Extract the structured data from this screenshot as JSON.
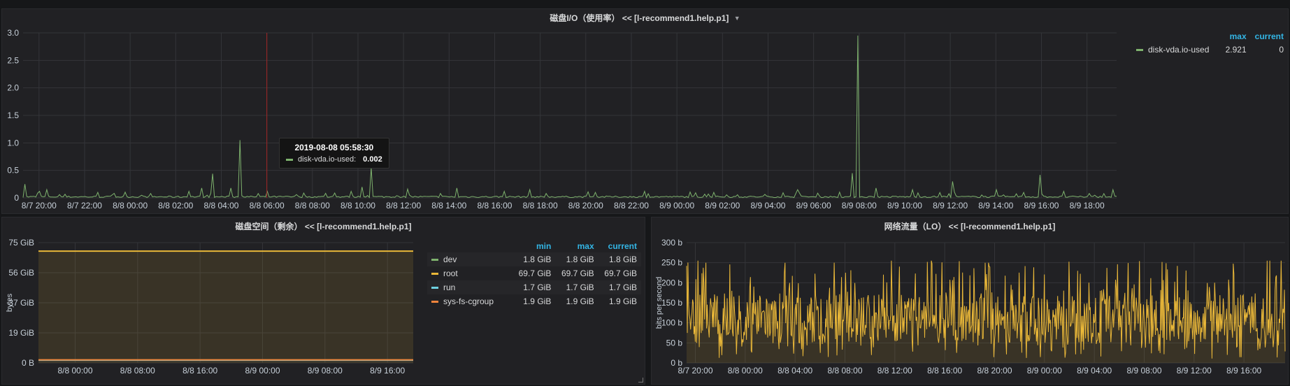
{
  "panels": {
    "io": {
      "title_cn": "磁盘I/O（使用率）",
      "title_host": "<< [l-recommend1.help.p1]",
      "chart_data": {
        "type": "line",
        "xlabel": "",
        "ylabel": "",
        "ylim": [
          0,
          3.0
        ],
        "y_ticks": [
          "0",
          "0.5",
          "1.0",
          "1.5",
          "2.0",
          "2.5",
          "3.0"
        ],
        "x_ticks": [
          "8/7 20:00",
          "8/7 22:00",
          "8/8 00:00",
          "8/8 02:00",
          "8/8 04:00",
          "8/8 06:00",
          "8/8 08:00",
          "8/8 10:00",
          "8/8 12:00",
          "8/8 14:00",
          "8/8 16:00",
          "8/8 18:00",
          "8/8 20:00",
          "8/8 22:00",
          "8/9 00:00",
          "8/9 02:00",
          "8/9 04:00",
          "8/9 06:00",
          "8/9 08:00",
          "8/9 10:00",
          "8/9 12:00",
          "8/9 14:00",
          "8/9 16:00",
          "8/9 18:00"
        ],
        "x_hours_start": 19.3,
        "x_hours_end": 67.3,
        "series": [
          {
            "name": "disk-vda.io-used",
            "color": "#7eb26d",
            "baseline": 0.02,
            "spikes": [
              [
                19.4,
                0.25
              ],
              [
                20.0,
                0.12
              ],
              [
                20.3,
                0.15
              ],
              [
                22.6,
                0.1
              ],
              [
                24.9,
                0.08
              ],
              [
                26.6,
                0.12
              ],
              [
                27.1,
                0.18
              ],
              [
                27.6,
                0.44
              ],
              [
                28.4,
                0.18
              ],
              [
                28.8,
                1.05
              ],
              [
                29.6,
                0.08
              ],
              [
                30.0,
                0.12
              ],
              [
                31.3,
                0.06
              ],
              [
                33.7,
                0.12
              ],
              [
                34.2,
                0.2
              ],
              [
                34.6,
                0.55
              ],
              [
                36.2,
                0.16
              ],
              [
                38.3,
                0.18
              ],
              [
                40.4,
                0.12
              ],
              [
                41.5,
                0.15
              ],
              [
                44.4,
                0.1
              ],
              [
                46.6,
                0.12
              ],
              [
                49.6,
                0.1
              ],
              [
                53.3,
                0.15
              ],
              [
                55.7,
                0.45
              ],
              [
                55.9,
                2.95
              ],
              [
                56.7,
                0.18
              ],
              [
                58.3,
                0.15
              ],
              [
                60.1,
                0.3
              ],
              [
                62.0,
                0.15
              ],
              [
                63.2,
                0.1
              ],
              [
                63.9,
                0.42
              ],
              [
                65.0,
                0.12
              ],
              [
                66.1,
                0.08
              ],
              [
                67.1,
                0.15
              ]
            ]
          }
        ],
        "legend_headers": {
          "max": "max",
          "current": "current"
        },
        "legend": [
          {
            "name": "disk-vda.io-used",
            "max": "2.921",
            "current": "0",
            "color": "#7eb26d"
          }
        ]
      },
      "tooltip": {
        "time": "2019-08-08 05:58:30",
        "series": "disk-vda.io-used:",
        "value": "0.002"
      }
    },
    "disk": {
      "title_cn": "磁盘空间（剩余）",
      "title_host": "<< [l-recommend1.help.p1]",
      "chart_data": {
        "type": "area",
        "ylabel": "bytes",
        "ylim": [
          0,
          75
        ],
        "y_ticks": [
          "0 B",
          "19 GiB",
          "37 GiB",
          "56 GiB",
          "75 GiB"
        ],
        "x_ticks": [
          "8/8 00:00",
          "8/8 08:00",
          "8/8 16:00",
          "8/9 00:00",
          "8/9 08:00",
          "8/9 16:00"
        ],
        "x_hours_start": 19.3,
        "x_hours_end": 67.3,
        "series": [
          {
            "name": "dev",
            "value_gib": 1.8,
            "color": "#7eb26d"
          },
          {
            "name": "root",
            "value_gib": 69.7,
            "color": "#eab839"
          },
          {
            "name": "run",
            "value_gib": 1.7,
            "color": "#6ed0e0"
          },
          {
            "name": "sys-fs-cgroup",
            "value_gib": 1.9,
            "color": "#ef843c"
          }
        ],
        "legend_headers": {
          "min": "min",
          "max": "max",
          "current": "current"
        },
        "legend": [
          {
            "name": "dev",
            "min": "1.8 GiB",
            "max": "1.8 GiB",
            "current": "1.8 GiB",
            "color": "#7eb26d"
          },
          {
            "name": "root",
            "min": "69.7 GiB",
            "max": "69.7 GiB",
            "current": "69.7 GiB",
            "color": "#eab839"
          },
          {
            "name": "run",
            "min": "1.7 GiB",
            "max": "1.7 GiB",
            "current": "1.7 GiB",
            "color": "#6ed0e0"
          },
          {
            "name": "sys-fs-cgroup",
            "min": "1.9 GiB",
            "max": "1.9 GiB",
            "current": "1.9 GiB",
            "color": "#ef843c"
          }
        ]
      }
    },
    "net": {
      "title_cn": "网络流量（LO）",
      "title_host": "<< [l-recommend1.help.p1]",
      "chart_data": {
        "type": "area",
        "ylabel": "bits per second",
        "ylim": [
          0,
          300
        ],
        "y_ticks": [
          "0 b",
          "50 b",
          "100 b",
          "150 b",
          "200 b",
          "250 b",
          "300 b"
        ],
        "x_ticks": [
          "8/7 20:00",
          "8/8 00:00",
          "8/8 04:00",
          "8/8 08:00",
          "8/8 12:00",
          "8/8 16:00",
          "8/8 20:00",
          "8/9 00:00",
          "8/9 04:00",
          "8/9 08:00",
          "8/9 12:00",
          "8/9 16:00"
        ],
        "x_hours_start": 19.3,
        "x_hours_end": 67.3,
        "series": [
          {
            "name": "",
            "color": "#eab839",
            "mean": 110,
            "min": 10,
            "max": 255
          }
        ]
      }
    }
  }
}
